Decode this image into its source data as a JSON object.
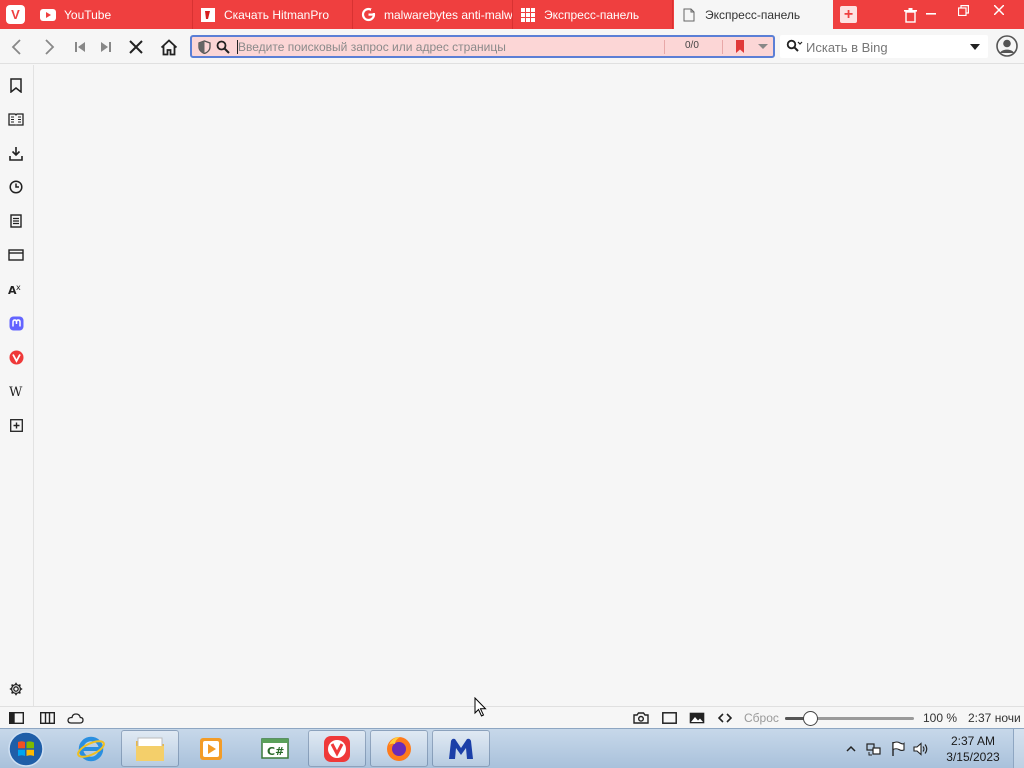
{
  "tabs": [
    {
      "title": "YouTube",
      "icon": "youtube-icon"
    },
    {
      "title": "Скачать HitmanPro",
      "icon": "hitmanpro-icon"
    },
    {
      "title": "malwarebytes anti-malw",
      "icon": "google-icon"
    },
    {
      "title": "Экспресс-панель",
      "icon": "grid-icon"
    },
    {
      "title": "Экспресс-панель",
      "icon": "page-icon",
      "active": true
    }
  ],
  "address": {
    "placeholder": "Введите поисковый запрос или адрес страницы",
    "match_count": "0/0"
  },
  "search": {
    "placeholder": "Искать в Bing"
  },
  "status": {
    "reset_label": "Сброс",
    "zoom_label": "100 %",
    "zoom_level": 0.2,
    "clock": "2:37 ночи"
  },
  "taskbar": {
    "time": "2:37 AM",
    "date": "3/15/2023"
  },
  "colors": {
    "accent": "#ef3f3f",
    "url_bg": "#fcd6d6",
    "url_border": "#5b7fd6"
  }
}
